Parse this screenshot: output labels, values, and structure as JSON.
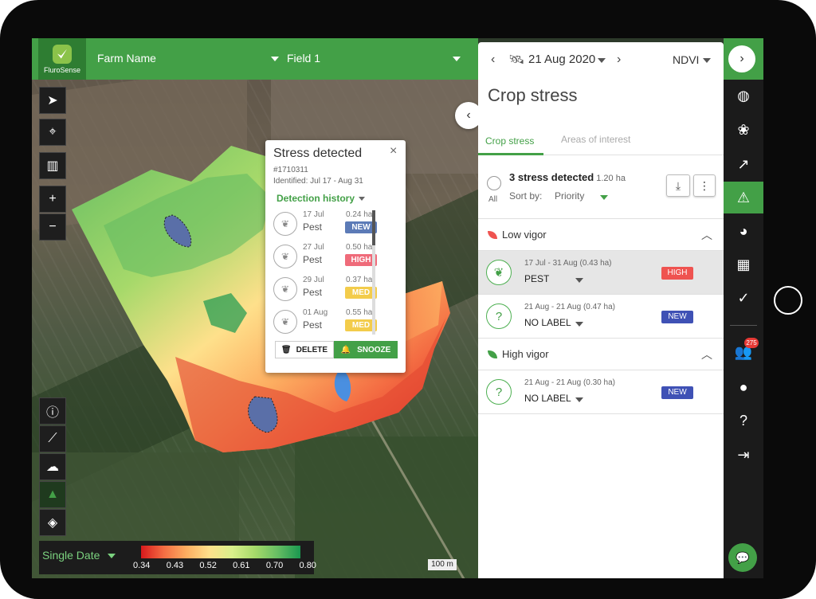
{
  "app": {
    "logo_text": "FluroSense",
    "farm_name": "Farm Name",
    "field_name": "Field 1"
  },
  "legend": {
    "mode": "Single Date",
    "ticks": [
      "0.34",
      "0.43",
      "0.52",
      "0.61",
      "0.70",
      "0.80"
    ]
  },
  "scale_label": "100 m",
  "popup": {
    "title": "Stress detected",
    "close": "×",
    "id": "#1710311",
    "identified": "Identified:  Jul 17 - Aug 31",
    "history_label": "Detection history",
    "rows": [
      {
        "date": "17 Jul",
        "label": "Pest",
        "area": "0.24 ha",
        "badge": "NEW",
        "badge_color": "#5c7bb7"
      },
      {
        "date": "27 Jul",
        "label": "Pest",
        "area": "0.50 ha",
        "badge": "HIGH",
        "badge_color": "#ef6b7a"
      },
      {
        "date": "29 Jul",
        "label": "Pest",
        "area": "0.37 ha",
        "badge": "MED",
        "badge_color": "#f3cc4b"
      },
      {
        "date": "01 Aug",
        "label": "Pest",
        "area": "0.55 ha",
        "badge": "MED",
        "badge_color": "#f3cc4b"
      }
    ],
    "delete_label": "DELETE",
    "snooze_label": "SNOOZE"
  },
  "panel": {
    "date": "21 Aug 2020",
    "layer": "NDVI",
    "title": "Crop stress",
    "tabs": [
      "Crop stress",
      "Areas of interest"
    ],
    "summary": {
      "count_text": "3 stress detected",
      "area": "1.20 ha",
      "all_label": "All",
      "sort_label": "Sort by:",
      "sort_value": "Priority"
    },
    "sections": [
      {
        "name": "Low vigor",
        "leaf_color": "#ef5350",
        "items": [
          {
            "range": "17 Jul - 31 Aug (0.43 ha)",
            "label": "PEST",
            "badge": "HIGH",
            "badge_color": "#ef5350",
            "icon": "plant"
          }
        ]
      },
      {
        "name": "",
        "items": [
          {
            "range": "21 Aug - 21 Aug (0.47 ha)",
            "label": "NO LABEL",
            "badge": "NEW",
            "badge_color": "#3f51b5",
            "icon": "question"
          }
        ]
      },
      {
        "name": "High vigor",
        "leaf_color": "#43a047",
        "items": [
          {
            "range": "21 Aug - 21 Aug (0.30 ha)",
            "label": "NO LABEL",
            "badge": "NEW",
            "badge_color": "#3f51b5",
            "icon": "question"
          }
        ]
      }
    ]
  },
  "rail": {
    "badge_count": "275"
  },
  "colors": {
    "brand": "#43a047",
    "dark": "#1b1b1b"
  }
}
